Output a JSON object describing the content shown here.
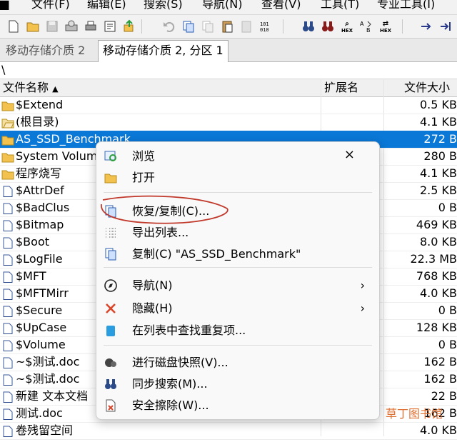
{
  "menu": [
    {
      "label": "文件(F)"
    },
    {
      "label": "编辑(E)"
    },
    {
      "label": "搜索(S)"
    },
    {
      "label": "导航(N)"
    },
    {
      "label": "查看(V)"
    },
    {
      "label": "工具(T)"
    },
    {
      "label": "专业工具(I)"
    }
  ],
  "toolbar": {
    "hex1": "HEX",
    "hex2": "HEX",
    "hex3": "HEX"
  },
  "tabs": {
    "inactive": "移动存储介质 2",
    "active": "移动存储介质 2, 分区 1"
  },
  "path": "\\",
  "columns": {
    "name": "文件名称",
    "ext": "扩展名",
    "size": "文件大小"
  },
  "files": [
    {
      "name": "$Extend",
      "size": "0.5 KB",
      "icon": "folder-icon"
    },
    {
      "name": "(根目录)",
      "size": "4.1 KB",
      "icon": "folder-open-icon"
    },
    {
      "name": "AS_SSD_Benchmark",
      "size": "272 B",
      "icon": "folder-icon",
      "selected": true
    },
    {
      "name": "System Volume Information",
      "size": "280 B",
      "icon": "folder-icon"
    },
    {
      "name": "程序烧写",
      "size": "4.1 KB",
      "icon": "folder-icon"
    },
    {
      "name": "$AttrDef",
      "size": "2.5 KB",
      "icon": "file-icon"
    },
    {
      "name": "$BadClus",
      "size": "0 B",
      "icon": "file-icon"
    },
    {
      "name": "$Bitmap",
      "size": "469 KB",
      "icon": "file-icon"
    },
    {
      "name": "$Boot",
      "size": "8.0 KB",
      "icon": "file-icon"
    },
    {
      "name": "$LogFile",
      "size": "22.3 MB",
      "icon": "file-icon"
    },
    {
      "name": "$MFT",
      "size": "768 KB",
      "icon": "file-icon"
    },
    {
      "name": "$MFTMirr",
      "size": "4.0 KB",
      "icon": "file-icon"
    },
    {
      "name": "$Secure",
      "size": "0 B",
      "icon": "file-icon"
    },
    {
      "name": "$UpCase",
      "size": "128 KB",
      "icon": "file-icon"
    },
    {
      "name": "$Volume",
      "size": "0 B",
      "icon": "file-icon"
    },
    {
      "name": "~$测试.doc",
      "size": "162 B",
      "icon": "file-icon"
    },
    {
      "name": "~$测试.doc",
      "size": "162 B",
      "icon": "file-icon"
    },
    {
      "name": "新建 文本文档",
      "size": "22 B",
      "icon": "file-icon"
    },
    {
      "name": "测试.doc",
      "size": "162 B",
      "icon": "file-icon"
    },
    {
      "name": "卷残留空间",
      "size": "4.0 KB",
      "icon": "file-icon"
    }
  ],
  "context_menu": {
    "close": "×",
    "items": [
      {
        "label": "浏览",
        "icon": "browse-icon"
      },
      {
        "label": "打开",
        "icon": "folder-icon"
      },
      {
        "label": "恢复/复制(C)...",
        "icon": "recover-copy-icon"
      },
      {
        "label": "导出列表...",
        "icon": "export-list-icon"
      },
      {
        "label": "复制(C) \"AS_SSD_Benchmark\"",
        "icon": "copy-icon"
      },
      {
        "label": "导航(N)",
        "icon": "compass-icon",
        "submenu": true
      },
      {
        "label": "隐藏(H)",
        "icon": "hide-x-icon",
        "submenu": true
      },
      {
        "label": "在列表中查找重复项...",
        "icon": "find-duplicates-icon"
      },
      {
        "label": "进行磁盘快照(V)...",
        "icon": "disk-snapshot-icon"
      },
      {
        "label": "同步搜索(M)...",
        "icon": "binoculars-icon"
      },
      {
        "label": "安全擦除(W)...",
        "icon": "secure-erase-icon"
      }
    ],
    "submenu_arrow": "›"
  },
  "watermark": "草丁图书馆",
  "colors": {
    "selection": "#0a78d7",
    "annotation": "#c0392b",
    "folder": "#f2c14e"
  }
}
